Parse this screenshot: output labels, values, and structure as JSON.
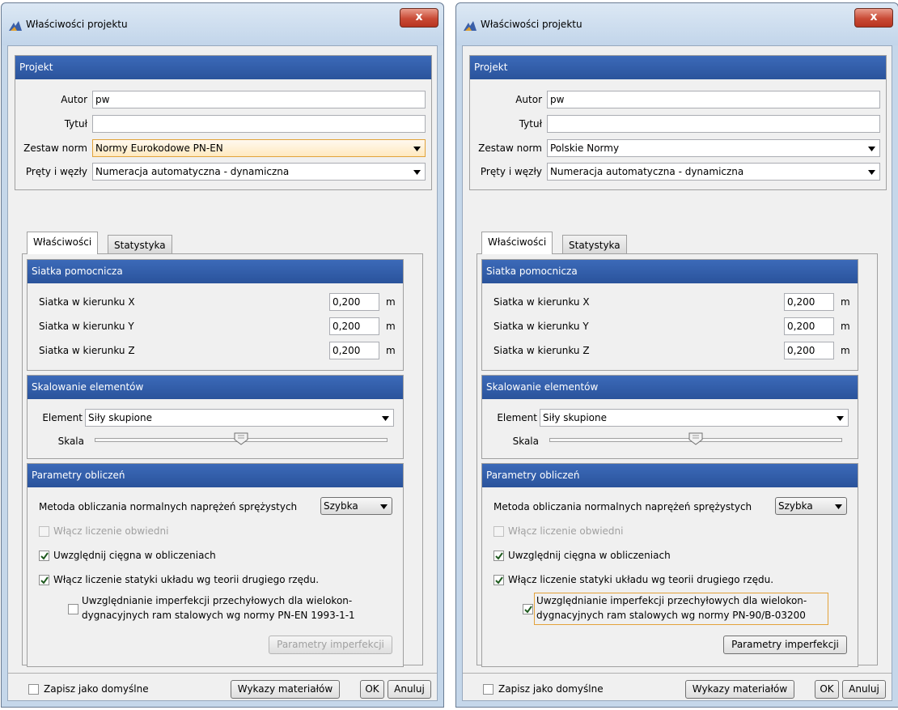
{
  "dialogs": [
    {
      "title": "Właściwości projektu",
      "close_label": "x",
      "project": {
        "header": "Projekt",
        "author_label": "Autor",
        "author_value": "pw",
        "title_label": "Tytuł",
        "title_value": "",
        "norms_label": "Zestaw norm",
        "norms_value": "Normy Eurokodowe PN-EN",
        "bars_label": "Pręty i węzły",
        "bars_value": "Numeracja automatyczna - dynamiczna"
      },
      "tabs": [
        "Właściwości",
        "Statystyka"
      ],
      "grid": {
        "header": "Siatka pomocnicza",
        "rows": [
          {
            "label": "Siatka w kierunku X",
            "value": "0,200",
            "unit": "m"
          },
          {
            "label": "Siatka w kierunku Y",
            "value": "0,200",
            "unit": "m"
          },
          {
            "label": "Siatka w kierunku Z",
            "value": "0,200",
            "unit": "m"
          }
        ]
      },
      "scaling": {
        "header": "Skalowanie elementów",
        "element_label": "Element",
        "element_value": "Siły skupione",
        "scale_label": "Skala",
        "scale_level": 0.5
      },
      "calc": {
        "header": "Parametry obliczeń",
        "method_label": "Metoda obliczania normalnych naprężeń sprężystych",
        "method_value": "Szybka",
        "envelope_label": "Włącz liczenie obwiedni",
        "envelope_checked": false,
        "envelope_enabled": false,
        "cables_label": "Uwzględnij cięgna w obliczeniach",
        "cables_checked": true,
        "second_order_label": "Włącz liczenie statyki układu wg teorii drugiego rzędu.",
        "second_order_checked": true,
        "imperfection_line1": "Uwzględnianie imperfekcji przechyłowych dla wielokon-",
        "imperfection_line2": "dygnacyjnych ram stalowych wg normy PN-EN 1993-1-1",
        "imperfection_checked": false,
        "imperfection_button": "Parametry imperfekcji",
        "imperfection_button_enabled": false
      },
      "footer": {
        "save_default_label": "Zapisz jako domyślne",
        "materials_button": "Wykazy materiałów",
        "ok_button": "OK",
        "cancel_button": "Anuluj"
      }
    },
    {
      "title": "Właściwości projektu",
      "close_label": "x",
      "project": {
        "header": "Projekt",
        "author_label": "Autor",
        "author_value": "pw",
        "title_label": "Tytuł",
        "title_value": "",
        "norms_label": "Zestaw norm",
        "norms_value": "Polskie Normy",
        "bars_label": "Pręty i węzły",
        "bars_value": "Numeracja automatyczna - dynamiczna"
      },
      "tabs": [
        "Właściwości",
        "Statystyka"
      ],
      "grid": {
        "header": "Siatka pomocnicza",
        "rows": [
          {
            "label": "Siatka w kierunku X",
            "value": "0,200",
            "unit": "m"
          },
          {
            "label": "Siatka w kierunku Y",
            "value": "0,200",
            "unit": "m"
          },
          {
            "label": "Siatka w kierunku Z",
            "value": "0,200",
            "unit": "m"
          }
        ]
      },
      "scaling": {
        "header": "Skalowanie elementów",
        "element_label": "Element",
        "element_value": "Siły skupione",
        "scale_label": "Skala",
        "scale_level": 0.5
      },
      "calc": {
        "header": "Parametry obliczeń",
        "method_label": "Metoda obliczania normalnych naprężeń sprężystych",
        "method_value": "Szybka",
        "envelope_label": "Włącz liczenie obwiedni",
        "envelope_checked": false,
        "envelope_enabled": false,
        "cables_label": "Uwzględnij cięgna w obliczeniach",
        "cables_checked": true,
        "second_order_label": "Włącz liczenie statyki układu wg teorii drugiego rzędu.",
        "second_order_checked": true,
        "imperfection_line1": "Uwzględnianie imperfekcji przechyłowych dla wielokon-",
        "imperfection_line2": "dygnacyjnych ram stalowych wg normy PN-90/B-03200",
        "imperfection_checked": true,
        "imperfection_button": "Parametry imperfekcji",
        "imperfection_button_enabled": true
      },
      "footer": {
        "save_default_label": "Zapisz jako domyślne",
        "materials_button": "Wykazy materiałów",
        "ok_button": "OK",
        "cancel_button": "Anuluj"
      }
    }
  ]
}
